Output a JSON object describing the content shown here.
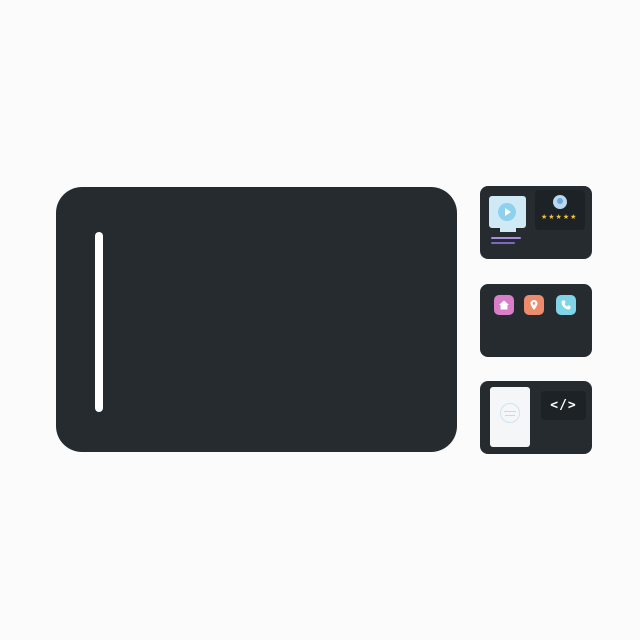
{
  "cards": {
    "reviews": {
      "stars": "★★★★★",
      "rating": 5,
      "star_color": "#f2c23a"
    },
    "apps": {
      "icons": [
        "home-icon",
        "location-pin-icon",
        "phone-icon"
      ],
      "colors": [
        "#d97fc9",
        "#ed8c6c",
        "#7fd4e8"
      ]
    },
    "code": {
      "code_symbol": "</>"
    }
  },
  "colors": {
    "background": "#fbfbfc",
    "panel": "#262b30",
    "panel_inner": "#1d2227",
    "cursor": "#ffffff"
  }
}
